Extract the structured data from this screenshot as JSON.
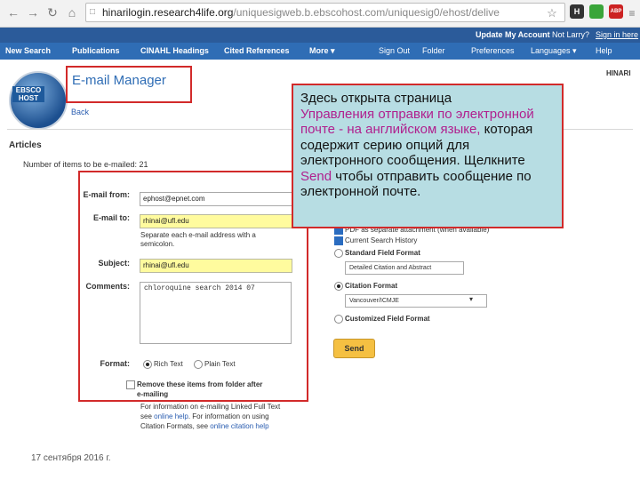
{
  "browser": {
    "url_prefix": "hinarilogin.research4life.org",
    "url_rest": "/uniquesigweb.b.ebscohost.com/uniquesig0/ehost/delive",
    "ext1": "H",
    "ext2": "ABP"
  },
  "toolbar": {
    "update_account": "Update My Account",
    "not_user": "Not Larry?",
    "sign_in": "Sign in here"
  },
  "menu": {
    "new_search": "New Search",
    "publications": "Publications",
    "cinahl": "CINAHL Headings",
    "cited": "Cited References",
    "more": "More ▾",
    "sign_out": "Sign Out",
    "folder": "Folder",
    "preferences": "Preferences",
    "languages": "Languages ▾",
    "help": "Help"
  },
  "logo_text": "EBSCO HOST",
  "header": {
    "title": "E-mail Manager",
    "back": "Back",
    "org": "HINARI"
  },
  "articles": {
    "heading": "Articles",
    "count_label": "Number of items to be e-mailed: 21"
  },
  "form": {
    "from_label": "E-mail from:",
    "from_value": "ephost@epnet.com",
    "to_label": "E-mail to:",
    "to_value": "rhinai@ufl.edu",
    "to_hint_1": "Separate each e-mail address with a",
    "to_hint_2": "semicolon.",
    "subject_label": "Subject:",
    "subject_value": "rhinai@ufl.edu",
    "comments_label": "Comments:",
    "comments_value": "chloroquine search 2014 07",
    "format_label": "Format:",
    "rich_text": "Rich Text",
    "plain_text": "Plain Text",
    "remove_label_1": "Remove these items from folder after",
    "remove_label_2": "e-mailing",
    "info_1": "For information on e-mailing Linked Full Text",
    "info_2a": "see ",
    "info_2_link": "online help",
    "info_2b": ". For information on using",
    "info_3a": "Citation Formats, see ",
    "info_3_link": "online citation help"
  },
  "options": {
    "pdf_attach": "PDF as separate attachment (when available)",
    "current_search": "Current Search History",
    "standard_format": "Standard Field Format",
    "standard_select": "Detailed Citation and Abstract",
    "citation_format": "Citation Format",
    "citation_select": "Vancouver/ICMJE",
    "customized": "Customized Field Format",
    "send": "Send"
  },
  "callout": {
    "line1": "Здесь открыта страница",
    "hl1": "Управления отправки по электронной почте - на английском языке,",
    "line2": " которая содержит серию опций для электронного сообщения. Щелкните ",
    "hl2": "Send",
    "line3": " чтобы отправить сообщение по электронной почте."
  },
  "date": "17 сентября 2016 г."
}
